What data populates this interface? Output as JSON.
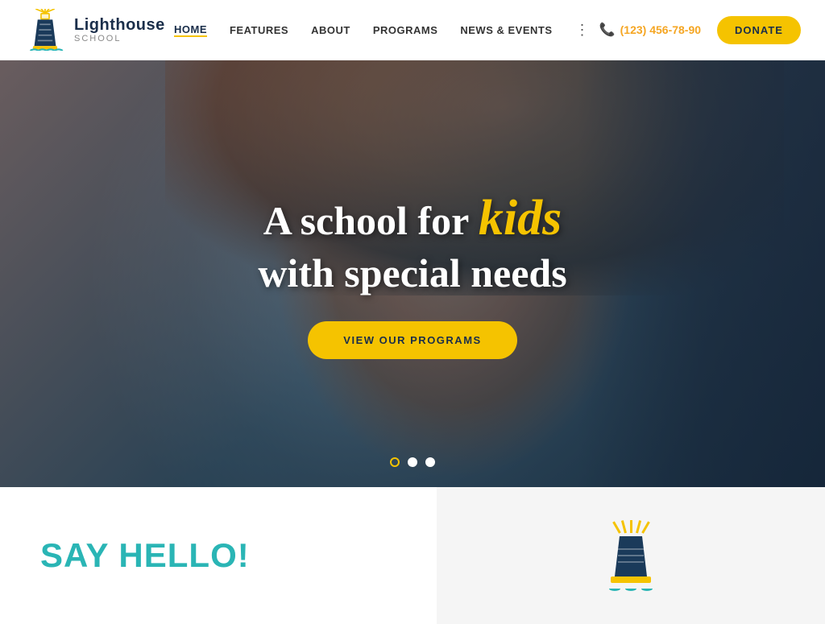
{
  "header": {
    "logo": {
      "main": "Lighthouse",
      "sub": "SCHOOL"
    },
    "nav": {
      "items": [
        {
          "label": "HOME",
          "active": true
        },
        {
          "label": "FEATURES",
          "active": false
        },
        {
          "label": "ABOUT",
          "active": false
        },
        {
          "label": "PROGRAMS",
          "active": false
        },
        {
          "label": "NEWS & EVENTS",
          "active": false
        }
      ],
      "more_icon": "⋮"
    },
    "phone": "(123) 456-78-90",
    "donate_label": "DONATE"
  },
  "hero": {
    "line1": "A school for",
    "kids_word": "kids",
    "line2": "with special needs",
    "cta_label": "VIEW OUR PROGRAMS",
    "dots": [
      {
        "active": true
      },
      {
        "active": false
      },
      {
        "active": false
      }
    ]
  },
  "bottom": {
    "say_hello": "SAY HELLO!"
  }
}
